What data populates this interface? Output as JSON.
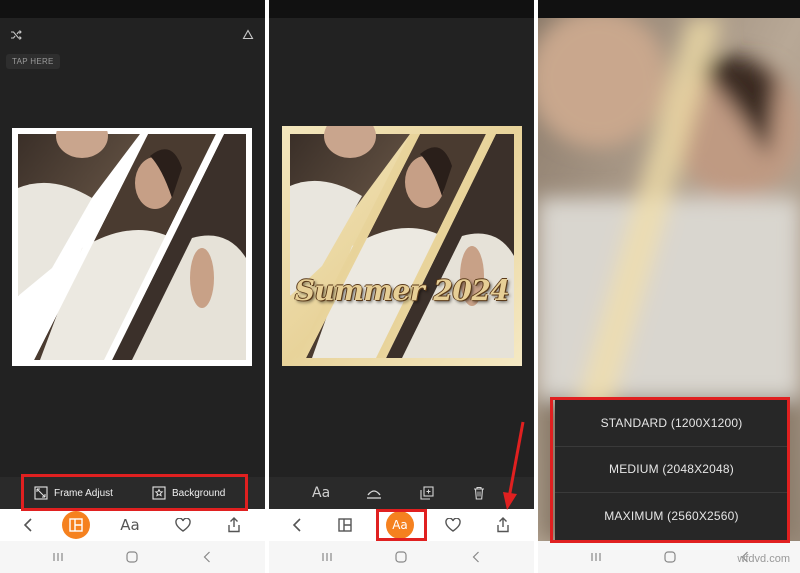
{
  "panel1": {
    "tap_here": "TAP HERE",
    "subbar": {
      "frame_adjust": "Frame Adjust",
      "background": "Background"
    },
    "top_icons": [
      "shuffle-icon",
      "eraser-icon"
    ]
  },
  "panel2": {
    "overlay_text": "Summer 2024",
    "edit_toolbar": {
      "text_label": "Aa"
    }
  },
  "navbar": {
    "text_label": "Aa"
  },
  "panel3": {
    "resolution_options": [
      {
        "label": "STANDARD (1200X1200)"
      },
      {
        "label": "MEDIUM (2048X2048)"
      },
      {
        "label": "MAXIMUM (2560X2560)"
      }
    ]
  },
  "watermark": "wfdvd.com",
  "colors": {
    "accent_orange": "#f5811f",
    "highlight_red": "#e02020",
    "frame_white": "#ffffff",
    "frame_cream": "#f0e0b0",
    "app_dark": "#222222"
  }
}
